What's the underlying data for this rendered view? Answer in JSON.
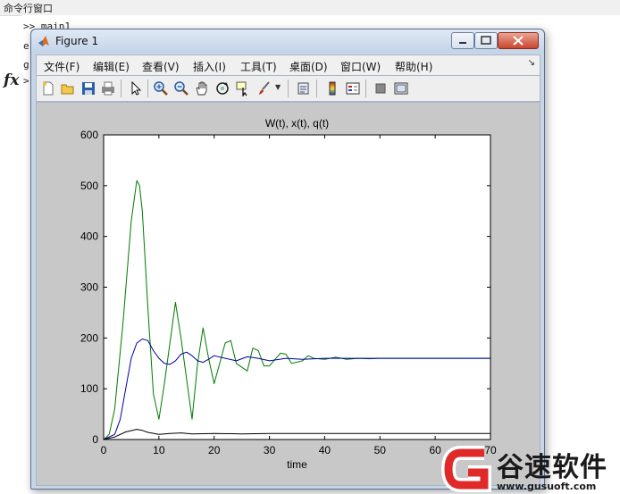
{
  "command_window": {
    "title": "命令行窗口",
    "lines": [
      ">> main1",
      "e",
      "g",
      ">"
    ]
  },
  "figure": {
    "title": "Figure 1",
    "menu": [
      "文件(F)",
      "编辑(E)",
      "查看(V)",
      "插入(I)",
      "工具(T)",
      "桌面(D)",
      "窗口(W)",
      "帮助(H)"
    ],
    "toolbar_icons": [
      "new-figure-icon",
      "open-file-icon",
      "save-icon",
      "print-icon",
      "pointer-icon",
      "zoom-in-icon",
      "zoom-out-icon",
      "pan-icon",
      "rotate-3d-icon",
      "data-cursor-icon",
      "brush-icon",
      "link-plot-icon",
      "colorbar-icon",
      "legend-icon",
      "hide-plot-tools-icon",
      "show-plot-tools-icon"
    ]
  },
  "chart_data": {
    "type": "line",
    "title": "W(t), x(t), q(t)",
    "xlabel": "time",
    "ylabel": "",
    "xlim": [
      0,
      70
    ],
    "ylim": [
      0,
      600
    ],
    "xticks": [
      0,
      10,
      20,
      30,
      40,
      50,
      60,
      70
    ],
    "yticks": [
      0,
      100,
      200,
      300,
      400,
      500,
      600
    ],
    "grid": false,
    "series": [
      {
        "color": "#007a00",
        "x": [
          0,
          1,
          2,
          3.5,
          5,
          6,
          6.5,
          7,
          8,
          9,
          10,
          11,
          13,
          14,
          16,
          17,
          18,
          19,
          20,
          22,
          23,
          24,
          26,
          27,
          28,
          29,
          30,
          32,
          33,
          34,
          36,
          37,
          38,
          40,
          42,
          44,
          46,
          48,
          50,
          53,
          56,
          60,
          65,
          70
        ],
        "values": [
          0,
          10,
          60,
          230,
          430,
          510,
          500,
          450,
          260,
          90,
          40,
          110,
          270,
          200,
          40,
          150,
          220,
          160,
          110,
          190,
          195,
          150,
          135,
          180,
          175,
          145,
          145,
          170,
          168,
          150,
          155,
          165,
          160,
          158,
          162,
          158,
          160,
          159,
          160,
          160,
          160,
          160,
          160,
          160
        ]
      },
      {
        "color": "#0000a0",
        "x": [
          0,
          2,
          3,
          4,
          5,
          6,
          7,
          8,
          9,
          10,
          11,
          12,
          13,
          14,
          15,
          16,
          17,
          18,
          19,
          20,
          22,
          24,
          26,
          28,
          30,
          33,
          36,
          40,
          45,
          50,
          55,
          60,
          70
        ],
        "values": [
          0,
          10,
          40,
          100,
          160,
          190,
          198,
          195,
          175,
          160,
          150,
          148,
          155,
          168,
          172,
          165,
          155,
          152,
          158,
          165,
          160,
          155,
          163,
          160,
          155,
          160,
          158,
          160,
          160,
          160,
          160,
          160,
          160
        ]
      },
      {
        "color": "#000000",
        "x": [
          0,
          2,
          4,
          6,
          7,
          8,
          10,
          12,
          14,
          16,
          20,
          25,
          30,
          40,
          50,
          60,
          70
        ],
        "values": [
          0,
          5,
          15,
          20,
          18,
          14,
          10,
          12,
          13,
          11,
          12,
          11,
          12,
          12,
          12,
          12,
          12
        ]
      }
    ]
  },
  "watermark": {
    "name": "谷速软件",
    "url": "www.gusuoft.com"
  }
}
